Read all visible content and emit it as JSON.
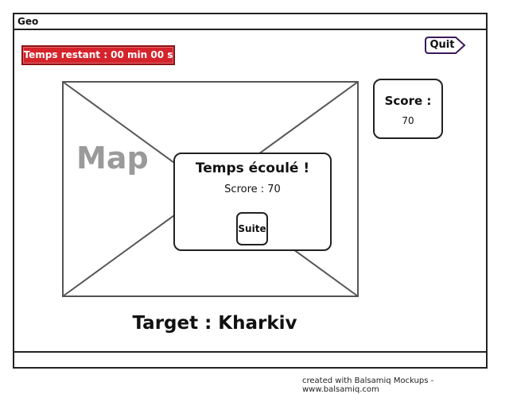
{
  "window": {
    "title": "Geo"
  },
  "timer": {
    "label": "Temps restant : 00 min 00 s"
  },
  "toolbar": {
    "quit_label": "Quit"
  },
  "map": {
    "label": "Map"
  },
  "score_panel": {
    "title": "Score :",
    "value": "70"
  },
  "dialog": {
    "title": "Temps écoulé !",
    "score_text": "Scrore : 70",
    "next_label": "Suite"
  },
  "target": {
    "text": "Target : Kharkiv"
  },
  "footer": {
    "credit": "created with Balsamiq Mockups - www.balsamiq.com"
  },
  "colors": {
    "timer_bg": "#d4232b",
    "ink": "#222222",
    "map_label": "#9a9a9a",
    "quit_accent": "#3b1a5a"
  }
}
